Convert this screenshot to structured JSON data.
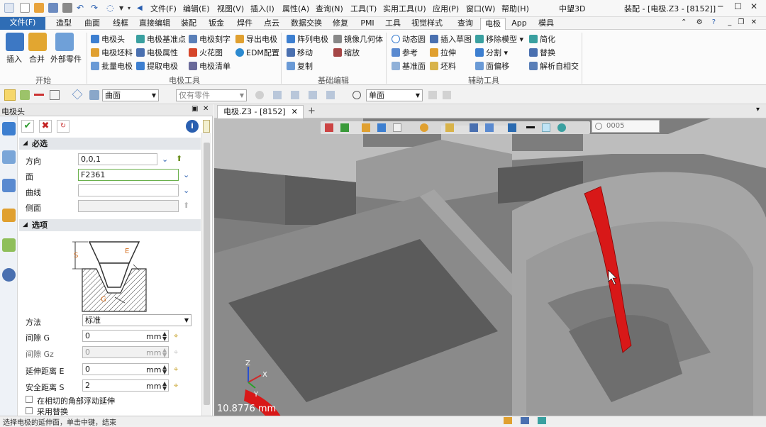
{
  "titlebar": {
    "menu": [
      "文件(F)",
      "编辑(E)",
      "视图(V)",
      "插入(I)",
      "属性(A)",
      "查询(N)",
      "工具(T)",
      "实用工具(U)",
      "应用(P)",
      "窗口(W)",
      "帮助(H)"
    ],
    "brand": "中望3D",
    "doc_title": "装配 - [电极.Z3 - [8152]]"
  },
  "tabs": [
    "文件(F)",
    "造型",
    "曲面",
    "线框",
    "直接编辑",
    "装配",
    "钣金",
    "焊件",
    "点云",
    "数据交换",
    "修复",
    "PMI",
    "工具",
    "视觉样式",
    "查询",
    "电极",
    "App",
    "模具"
  ],
  "active_tab": "电极",
  "ribbon": {
    "start_group": {
      "label": "开始",
      "buttons": [
        "插入",
        "合并",
        "外部零件"
      ]
    },
    "electrode_tools": {
      "label": "电极工具",
      "col1": [
        "电极头",
        "电极坯料",
        "批量电极"
      ],
      "col2": [
        "电极基准点",
        "电极属性",
        "提取电极"
      ],
      "col3": [
        "电极刻字",
        "火花图",
        "电极清单"
      ],
      "col4": [
        "导出电极",
        "EDM配置"
      ]
    },
    "basic_edit": {
      "label": "基础编辑",
      "col1": [
        "阵列电极",
        "移动",
        "复制"
      ],
      "col2": [
        "镜像几何体",
        "缩放"
      ]
    },
    "aux_tools": {
      "label": "辅助工具",
      "col1": [
        "动态圆",
        "参考",
        "基准面"
      ],
      "col2": [
        "插入草图",
        "拉伸",
        "坯料"
      ],
      "col3": [
        "移除模型",
        "分割",
        "面偏移"
      ],
      "col4": [
        "简化",
        "替换",
        "解析自相交"
      ]
    }
  },
  "toolbar2": {
    "filter": "曲面",
    "scope_placeholder": "仅有零件",
    "view": "单面"
  },
  "panel": {
    "title": "电极头",
    "required_section": "必选",
    "options_section": "选项",
    "fields": {
      "direction": {
        "label": "方向",
        "value": "0,0,1"
      },
      "face": {
        "label": "面",
        "value": "F2361"
      },
      "curve": {
        "label": "曲线",
        "value": ""
      },
      "side": {
        "label": "侧面",
        "value": ""
      }
    },
    "diagram": {
      "s": "S",
      "e": "E",
      "g": "G"
    },
    "method": {
      "label": "方法",
      "value": "标准"
    },
    "gap_g": {
      "label": "间隙 G",
      "value": "0",
      "unit": "mm"
    },
    "gap_gz": {
      "label": "间隙 Gz",
      "value": "0",
      "unit": "mm"
    },
    "extend_e": {
      "label": "延伸距离 E",
      "value": "0",
      "unit": "mm"
    },
    "safe_s": {
      "label": "安全距离 S",
      "value": "2",
      "unit": "mm"
    },
    "check1": "在相切的角部浮动延伸",
    "check2": "采用替换"
  },
  "viewport": {
    "tab": "电极.Z3 - [8152]",
    "new_tab": "+",
    "coord_readout": "0005",
    "measure": "10.8776 mm",
    "axes": {
      "x": "X",
      "y": "Y",
      "z": "Z"
    }
  },
  "status": {
    "text": "选择电极的延伸面，单击中键，结束"
  },
  "colors": {
    "file_tab": "#2f6db5",
    "highlight": "#d81818",
    "model_gray": "#8e8e8e"
  }
}
